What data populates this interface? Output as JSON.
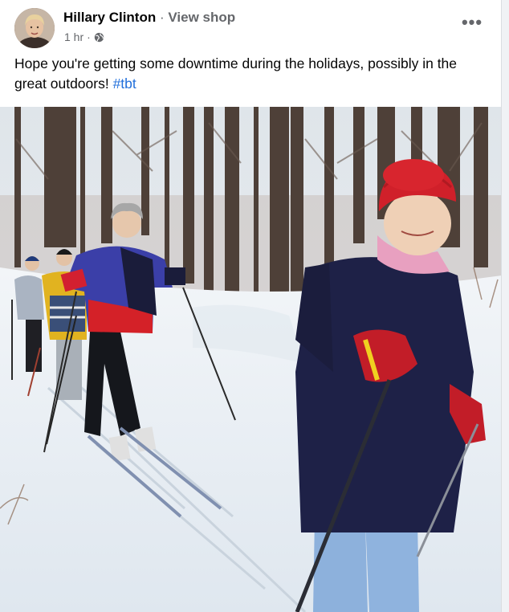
{
  "post": {
    "author": "Hillary Clinton",
    "separator": "·",
    "view_shop": "View shop",
    "time": "1 hr",
    "meta_separator": "·",
    "audience_icon": "globe-icon",
    "more_icon": "more-options-icon",
    "more_glyph": "•••",
    "text": "Hope you're getting some downtime during the holidays, possibly in the great outdoors! ",
    "hashtag": "#tbt"
  },
  "photo": {
    "alt": "Hillary Clinton and family cross-country skiing in a snowy forest",
    "colors": {
      "snow": "#eef3f8",
      "sky": "#e8edf2",
      "tree": "#5b4a3f",
      "red_hat": "#d0202a",
      "navy_jacket": "#1e2147",
      "jeans": "#8db1dc"
    }
  }
}
